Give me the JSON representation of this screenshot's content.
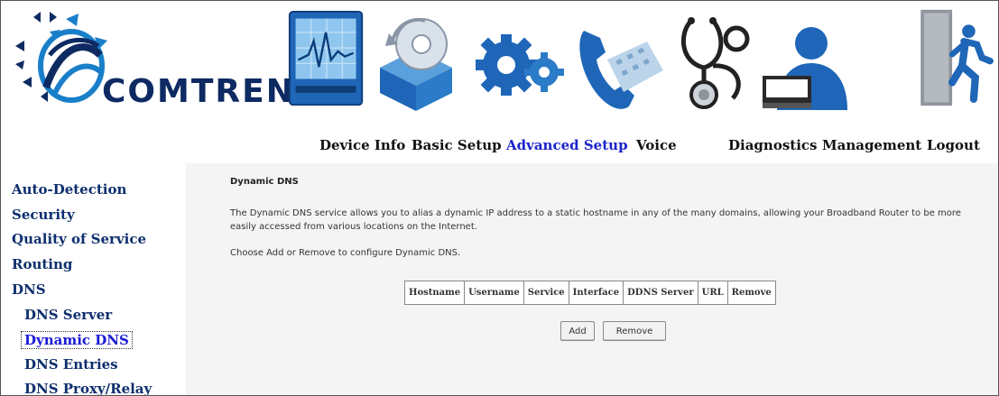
{
  "brand": {
    "logo_text": "COMTREND",
    "colors": {
      "logo_navy": "#0e2a62",
      "accent_blue": "#1a7fc9",
      "active_nav": "#1b24c8"
    }
  },
  "nav": {
    "items": [
      {
        "label": "Device Info",
        "icon": "monitor-chart-icon",
        "active": false
      },
      {
        "label": "Basic Setup",
        "icon": "disc-box-icon",
        "active": false
      },
      {
        "label": "Advanced Setup",
        "icon": "gears-icon",
        "active": true
      },
      {
        "label": "Voice",
        "icon": "phone-keypad-icon",
        "active": false
      },
      {
        "label": "Diagnostics",
        "icon": "stethoscope-icon",
        "active": false
      },
      {
        "label": "Management",
        "icon": "user-computer-icon",
        "active": false
      },
      {
        "label": "Logout",
        "icon": "exit-door-icon",
        "active": false
      }
    ]
  },
  "sidebar": {
    "items": [
      {
        "label": "Auto-Detection"
      },
      {
        "label": "Security"
      },
      {
        "label": "Quality of Service"
      },
      {
        "label": "Routing"
      },
      {
        "label": "DNS"
      },
      {
        "label": "DNS Server"
      },
      {
        "label": "Dynamic DNS",
        "selected": true
      },
      {
        "label": "DNS Entries"
      },
      {
        "label": "DNS Proxy/Relay"
      }
    ]
  },
  "main": {
    "title": "Dynamic DNS",
    "description": "The Dynamic DNS service allows you to alias a dynamic IP address to a static hostname in any of the many domains, allowing your Broadband Router to be more easily accessed from various locations on the Internet.",
    "instruction": "Choose Add or Remove to configure Dynamic DNS.",
    "table": {
      "columns": [
        "Hostname",
        "Username",
        "Service",
        "Interface",
        "DDNS Server",
        "URL",
        "Remove"
      ],
      "rows": []
    },
    "buttons": {
      "add": "Add",
      "remove": "Remove"
    }
  }
}
